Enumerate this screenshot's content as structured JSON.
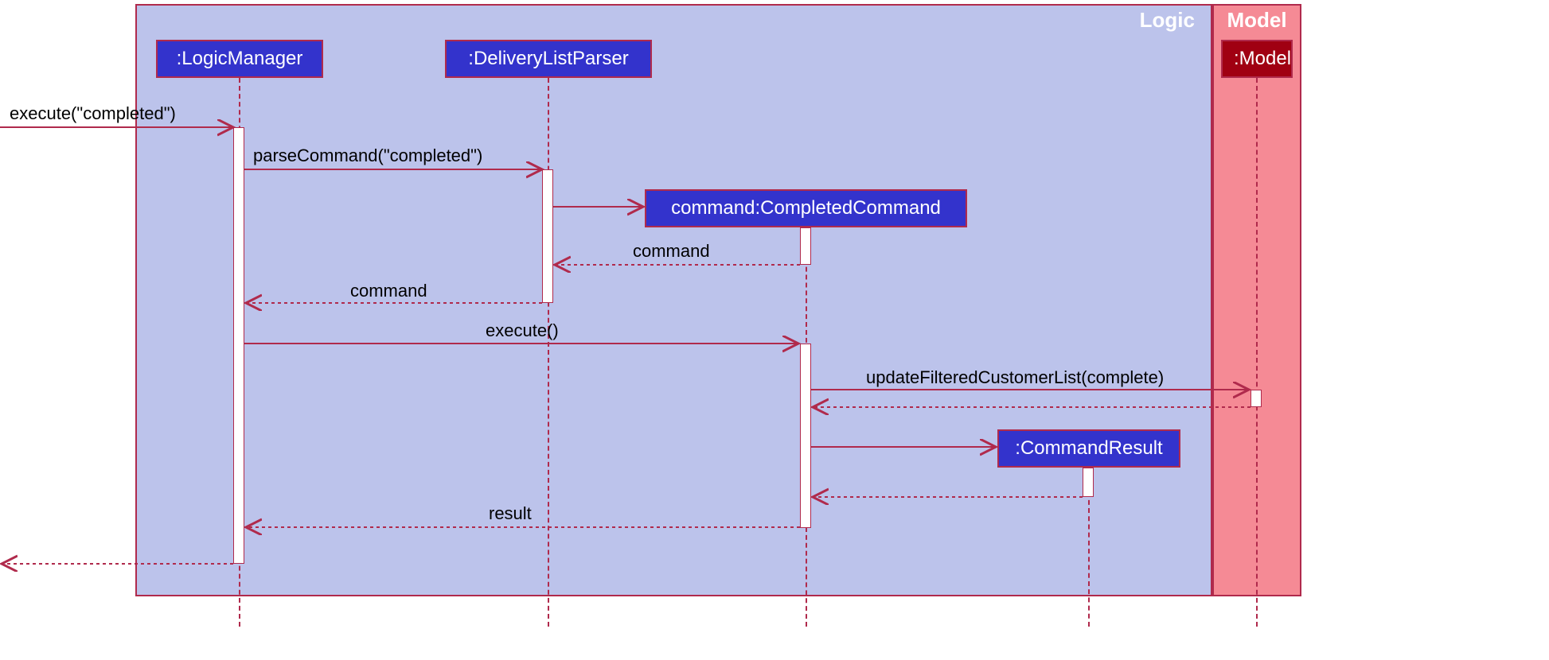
{
  "regions": {
    "logic": {
      "label": "Logic"
    },
    "model": {
      "label": "Model"
    }
  },
  "participants": {
    "logicManager": ":LogicManager",
    "deliveryListParser": ":DeliveryListParser",
    "completedCommand": "command:CompletedCommand",
    "commandResult": ":CommandResult",
    "model": ":Model"
  },
  "messages": {
    "execute_completed": "execute(\"completed\")",
    "parseCommand_completed": "parseCommand(\"completed\")",
    "command_return1": "command",
    "command_return2": "command",
    "execute_call": "execute()",
    "updateFilteredCustomerList": "updateFilteredCustomerList(complete)",
    "result_return": "result"
  },
  "colors": {
    "logicBg": "#bcc3eb",
    "logicBorder": "#b02a4c",
    "modelBg": "#f58a95",
    "modelBorder": "#b02a4c",
    "participantBg": "#3333cc",
    "participantBorder": "#b02a4c",
    "modelParticipantBg": "#a00012",
    "arrow": "#b02a4c"
  }
}
